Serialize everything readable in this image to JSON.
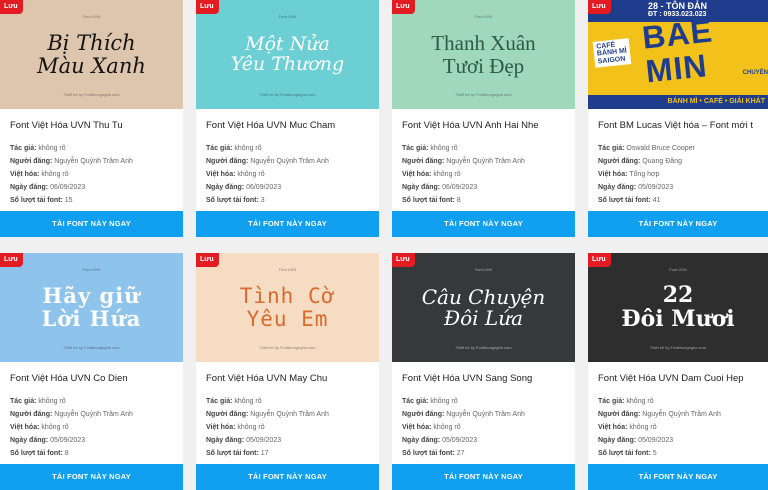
{
  "labels": {
    "save": "Lưu",
    "author": "Tác giả:",
    "poster": "Người đăng:",
    "localized": "Việt hóa:",
    "date": "Ngày đăng:",
    "downloads": "Số lượt tải font:",
    "download_button": "TẢI FONT NÀY NGAY",
    "preview_top": "Font UVN",
    "preview_bottom": "Thiết kế by Fontthongnghe.com"
  },
  "colors": {
    "badge": "#e31b23",
    "button": "#11a0f0",
    "page_bg": "#f0f0f0"
  },
  "cards": [
    {
      "title": "Font Việt Hóa UVN Thu Tu",
      "preview_lines": [
        "Bị Thích",
        "Màu Xanh"
      ],
      "author": "không rõ",
      "poster": "Nguyễn Quỳnh Trâm Anh",
      "localized": "không rõ",
      "date": "06/09/2023",
      "downloads": "15"
    },
    {
      "title": "Font Việt Hóa UVN Muc Cham",
      "preview_lines": [
        "Một Nửa",
        "Yêu Thương"
      ],
      "author": "không rõ",
      "poster": "Nguyễn Quỳnh Trâm Anh",
      "localized": "không rõ",
      "date": "06/09/2023",
      "downloads": "3"
    },
    {
      "title": "Font Việt Hóa UVN Anh Hai Nhe",
      "preview_lines": [
        "Thanh Xuân",
        "Tươi Đẹp"
      ],
      "author": "không rõ",
      "poster": "Nguyễn Quỳnh Trâm Anh",
      "localized": "không rõ",
      "date": "06/09/2023",
      "downloads": "8"
    },
    {
      "title": "Font BM Lucas Việt hóa – Font mới t",
      "preview_poster": {
        "top": "28 - TÔN ĐẢN",
        "phone": "ĐT : 0933.023.023",
        "cafe": [
          "CAFÉ",
          "BÁNH MÌ",
          "SAIGON"
        ],
        "big": [
          "BAE",
          "MIN"
        ],
        "side": "CHUYÊN",
        "bottom": "BÁNH MÌ • CAFÉ • GIẢI KHÁT"
      },
      "author": "Oswald Bruce Cooper",
      "poster": "Quang Đăng",
      "localized": "Tổng hợp",
      "date": "05/09/2023",
      "downloads": "41"
    },
    {
      "title": "Font Việt Hóa UVN Co Dien",
      "preview_lines": [
        "Hãy giữ",
        "Lời Hứa"
      ],
      "author": "không rõ",
      "poster": "Nguyễn Quỳnh Trâm Anh",
      "localized": "không rõ",
      "date": "05/09/2023",
      "downloads": "8"
    },
    {
      "title": "Font Việt Hóa UVN May Chu",
      "preview_lines": [
        "Tình Cờ",
        "Yêu Em"
      ],
      "author": "không rõ",
      "poster": "Nguyễn Quỳnh Trâm Anh",
      "localized": "không rõ",
      "date": "05/09/2023",
      "downloads": "17"
    },
    {
      "title": "Font Việt Hóa UVN Sang Song",
      "preview_lines": [
        "Câu Chuyện",
        "Đôi Lứa"
      ],
      "author": "không rõ",
      "poster": "Nguyễn Quỳnh Trâm Anh",
      "localized": "không rõ",
      "date": "05/09/2023",
      "downloads": "27"
    },
    {
      "title": "Font Việt Hóa UVN Dam Cuoi Hep",
      "preview_lines": [
        "22",
        "Đôi Mươi"
      ],
      "author": "không rõ",
      "poster": "Nguyễn Quỳnh Trâm Anh",
      "localized": "không rõ",
      "date": "05/09/2023",
      "downloads": "5"
    }
  ]
}
